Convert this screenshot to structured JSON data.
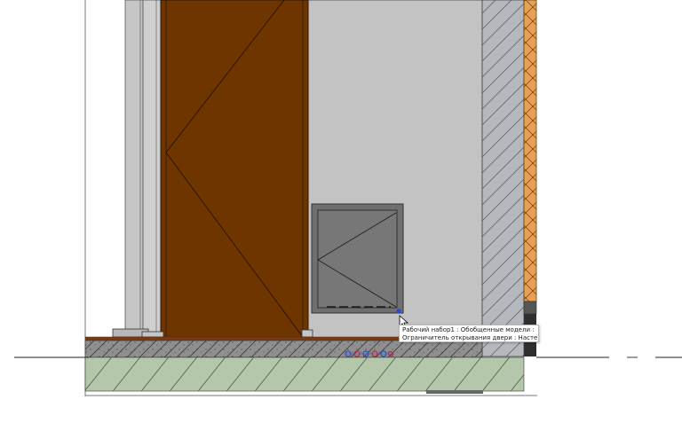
{
  "tooltip": {
    "line1": "Рабочий набор1 : Обобщенные модели :",
    "line2": "Ограничитель открывания двери : Настенный"
  },
  "colors": {
    "door_panel": "#6e3500",
    "wall_finish": "#c3c3c3",
    "recess_frame": "#6f6f6f",
    "gravel_fill": "#b4c7aa",
    "screed": "#8a8a8a",
    "insulation": "#e8a055",
    "masonry": "#a8abb2",
    "selected_grip": "#2b4fc7"
  },
  "icons": {
    "cursor": "arrow-cursor-icon",
    "door_stop_grips": "door-stop-grip-icons"
  }
}
